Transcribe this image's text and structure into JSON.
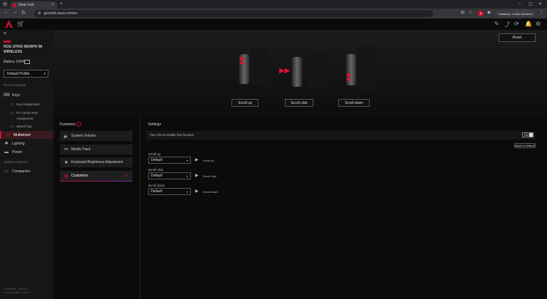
{
  "browser": {
    "tab_title": "Gear Link",
    "url": "gearlink.asus.com/en",
    "update_label": "Нажмите, чтобы обновить"
  },
  "sidebar": {
    "device_name": "ROG STRIX MORPH 96 WIRELESS",
    "battery": "Battery 100%",
    "profile": "Default Profile",
    "device_settings_label": "Device Settings",
    "items": [
      {
        "label": "Keys"
      },
      {
        "label": "Key Assignment"
      },
      {
        "label": "Fn Combo Key Assignment"
      },
      {
        "label": "Speed Tap"
      },
      {
        "label": "Multiwheel"
      },
      {
        "label": "Lighting"
      },
      {
        "label": "Power"
      }
    ],
    "system_features_label": "System Features",
    "companion": "Companion",
    "footer": [
      "Companion · Armoury...",
      "Current Version: 1.00.10"
    ]
  },
  "hero": {
    "reset_label": "Reset",
    "buttons": [
      "Scroll up",
      "Scroll click",
      "Scroll down"
    ]
  },
  "functions": {
    "title": "Functions",
    "items": [
      "System Volume",
      "Media Track",
      "Keyboard Brightness Adjustment",
      "Customize"
    ]
  },
  "settings": {
    "title": "Settings",
    "toggle_text": "Turn ON to enable this function",
    "toggle_state": "ON",
    "back_default": "Back to Default",
    "rows": [
      {
        "label": "Scroll up",
        "value": "Default",
        "action": "Scroll up"
      },
      {
        "label": "Scroll click",
        "value": "Default",
        "action": "Scroll click"
      },
      {
        "label": "Scroll down",
        "value": "Default",
        "action": "Scroll down"
      }
    ]
  },
  "colors": {
    "accent": "#c8102e",
    "active_bg": "#3a1a1e"
  }
}
